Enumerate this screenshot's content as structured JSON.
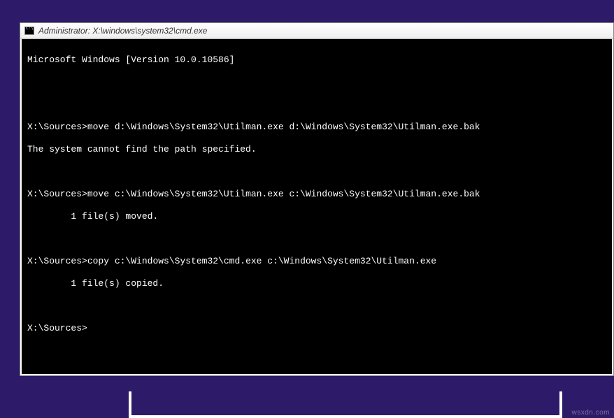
{
  "window": {
    "title": "Administrator: X:\\windows\\system32\\cmd.exe"
  },
  "console": {
    "version": "Microsoft Windows [Version 10.0.10586]",
    "blank1": "",
    "blank2": "",
    "line1_prompt": "X:\\Sources>",
    "line1_cmd": "move d:\\Windows\\System32\\Utilman.exe d:\\Windows\\System32\\Utilman.exe.bak",
    "line1_out": "The system cannot find the path specified.",
    "blank3": "",
    "line2_prompt": "X:\\Sources>",
    "line2_cmd": "move c:\\Windows\\System32\\Utilman.exe c:\\Windows\\System32\\Utilman.exe.bak",
    "line2_out": "        1 file(s) moved.",
    "blank4": "",
    "line3_prompt": "X:\\Sources>",
    "line3_cmd": "copy c:\\Windows\\System32\\cmd.exe c:\\Windows\\System32\\Utilman.exe",
    "line3_out": "        1 file(s) copied.",
    "blank5": "",
    "line4_prompt": "X:\\Sources>",
    "line4_cmd": ""
  },
  "watermark": "wsxdn.com"
}
